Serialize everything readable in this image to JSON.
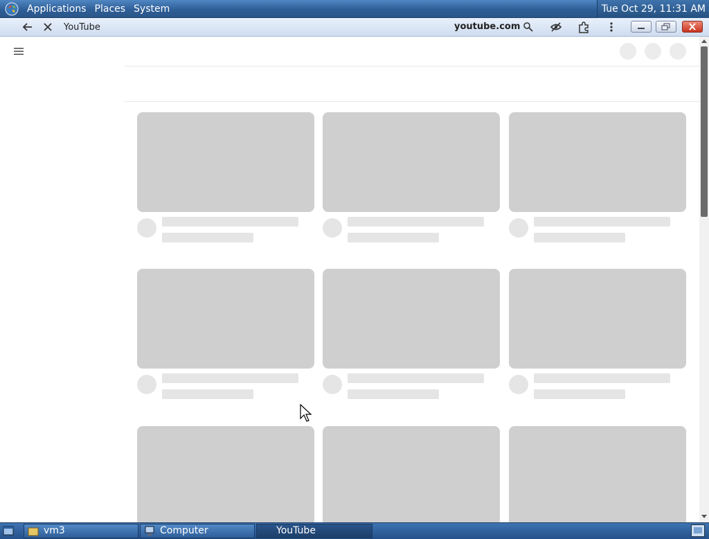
{
  "top_panel": {
    "menus": [
      "Applications",
      "Places",
      "System"
    ],
    "clock": "Tue Oct 29, 11:31 AM"
  },
  "browser": {
    "tab_title": "YouTube",
    "url": "youtube.com",
    "icons": [
      "back-arrow-icon",
      "stop-loading-icon",
      "zoom-icon",
      "tracking-protection-icon",
      "extensions-icon",
      "more-menu-icon"
    ]
  },
  "page": {
    "state": "loading skeleton",
    "grid_rows_visible": 3,
    "grid_columns": 3
  },
  "taskbar": {
    "items": [
      {
        "label": "vm3"
      },
      {
        "label": "Computer"
      },
      {
        "label": "YouTube"
      }
    ]
  },
  "colors": {
    "panel_blue": "#2f5f98",
    "skeleton_gray": "#cfcfcf",
    "close_red": "#c8341f"
  }
}
